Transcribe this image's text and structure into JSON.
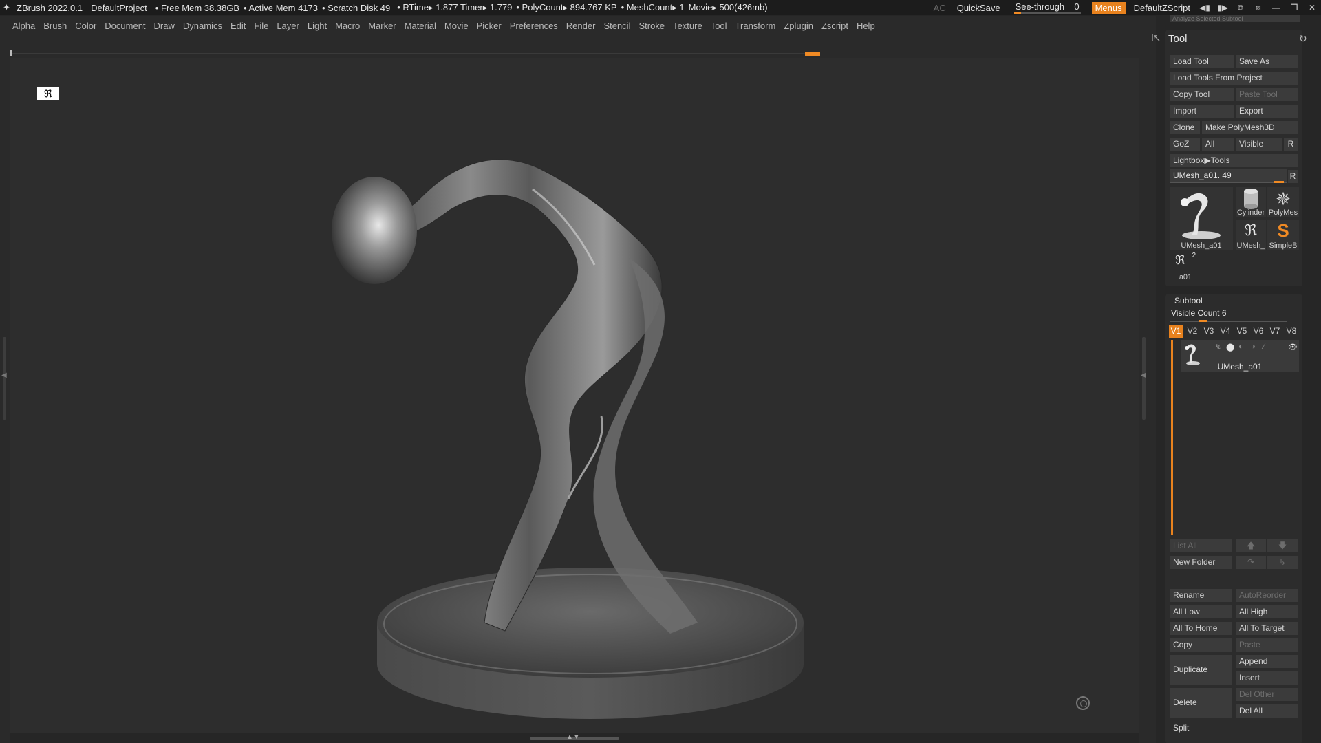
{
  "titlebar": {
    "app": "ZBrush 2022.0.1",
    "project": "DefaultProject",
    "free_mem": "• Free Mem 38.38GB",
    "active_mem": "• Active Mem 4173",
    "scratch_disk": "• Scratch Disk 49",
    "rtime": "• RTime▸ 1.877 Timer▸ 1.779",
    "polycount": "• PolyCount▸ 894.767 KP",
    "meshcount": "• MeshCount▸ 1",
    "movie": "Movie▸ 500(426mb)",
    "ac": "AC",
    "quicksave": "QuickSave",
    "seethrough_label": "See-through",
    "seethrough_value": "0",
    "menus": "Menus",
    "script": "DefaultZScript"
  },
  "menubar": [
    "Alpha",
    "Brush",
    "Color",
    "Document",
    "Draw",
    "Dynamics",
    "Edit",
    "File",
    "Layer",
    "Light",
    "Macro",
    "Marker",
    "Material",
    "Movie",
    "Picker",
    "Preferences",
    "Render",
    "Stencil",
    "Stroke",
    "Texture",
    "Tool",
    "Transform",
    "Zplugin",
    "Zscript",
    "Help"
  ],
  "palette": {
    "top_strip": "Analyze Selected Subtool",
    "tool": {
      "title": "Tool",
      "load_tool": "Load Tool",
      "save_as": "Save As",
      "load_from_project": "Load Tools From Project",
      "copy_tool": "Copy Tool",
      "paste_tool": "Paste Tool",
      "import": "Import",
      "export": "Export",
      "clone": "Clone",
      "make_polymesh": "Make PolyMesh3D",
      "goz": "GoZ",
      "all": "All",
      "visible": "Visible",
      "r": "R",
      "lightbox": "Lightbox▶Tools",
      "current": "UMesh_a01. 49",
      "thumbs": {
        "main": "UMesh_a01",
        "cylinder": "Cylinder",
        "polymesh": "PolyMes",
        "umesh_small": "UMesh_",
        "simpleb": "SimpleB",
        "a01": "a01",
        "a01_count": "2"
      }
    },
    "subtool": {
      "title": "Subtool",
      "visible_count": "Visible Count 6",
      "tabs": [
        "V1",
        "V2",
        "V3",
        "V4",
        "V5",
        "V6",
        "V7",
        "V8"
      ],
      "item_name": "UMesh_a01",
      "list_all": "List All",
      "new_folder": "New Folder",
      "rename": "Rename",
      "autoreorder": "AutoReorder",
      "all_low": "All Low",
      "all_high": "All High",
      "all_to_home": "All To Home",
      "all_to_target": "All To Target",
      "copy": "Copy",
      "paste": "Paste",
      "duplicate": "Duplicate",
      "append": "Append",
      "insert": "Insert",
      "delete": "Delete",
      "del_other": "Del Other",
      "del_all": "Del All",
      "split": "Split"
    }
  },
  "colors": {
    "accent": "#e8821e",
    "viewport_bg": "#2d2d2d",
    "panel_bg": "#2c2c2c",
    "button_bg": "#3b3b3b"
  },
  "icons": {
    "app": "zbrush-logo-icon",
    "pin": "pin-icon",
    "refresh": "refresh-icon",
    "gizmo": "navigation-gizmo-icon"
  }
}
